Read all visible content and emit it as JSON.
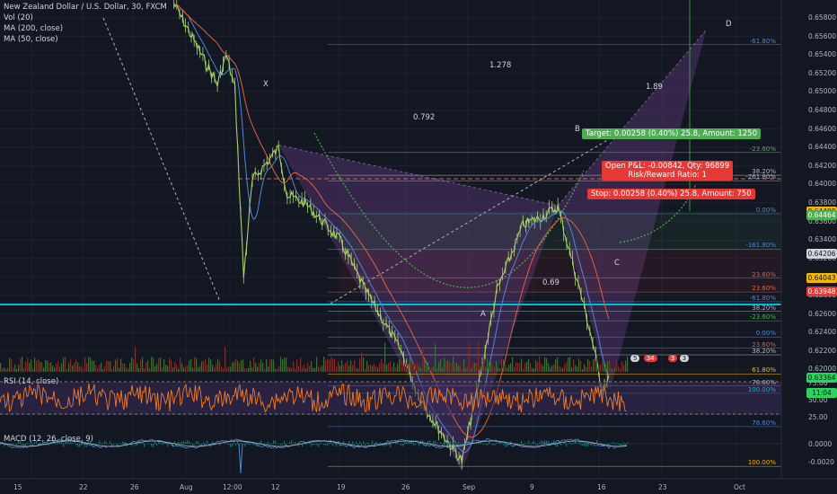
{
  "legend": {
    "symbol": "New Zealand Dollar / U.S. Dollar, 30, FXCM",
    "vol": "Vol (20)",
    "ma200": "MA (200, close)",
    "ma50": "MA (50, close)",
    "rsi": "RSI (14, close)",
    "macd": "MACD (12, 26, close, 9)"
  },
  "colors": {
    "background": "#131722",
    "candle": "#a4d36b",
    "ma200": "#e0613f",
    "ma50": "#4f86d9",
    "harmonic_fill": "#5b3a78",
    "rsi": "#f57c1f",
    "target_box": "#4caf50",
    "stop_box": "#e53935",
    "cup_curve": "#4caf50",
    "support_line": "#00bcd4"
  },
  "price_axis": {
    "ticks": [
      "0.65800",
      "0.65600",
      "0.65400",
      "0.65200",
      "0.65000",
      "0.64800",
      "0.64600",
      "0.64400",
      "0.64200",
      "0.64000",
      "0.63800",
      "0.63600",
      "0.63400",
      "0.63200",
      "0.63000",
      "0.62800",
      "0.62600",
      "0.62400",
      "0.62200",
      "0.62000"
    ],
    "tags": [
      {
        "text": "0.64490",
        "bg": "#f7b500",
        "fg": "#131722",
        "price": 0.6449
      },
      {
        "text": "0.64464",
        "bg": "#4caf50",
        "fg": "#ffffff",
        "price": 0.64464
      },
      {
        "text": "0.64206",
        "bg": "#d1d4dc",
        "fg": "#131722",
        "price": 0.64206
      },
      {
        "text": "0.64043",
        "bg": "#f7b500",
        "fg": "#131722",
        "price": 0.64043
      },
      {
        "text": "0.63948",
        "bg": "#e53935",
        "fg": "#ffffff",
        "price": 0.63948
      },
      {
        "text": "0.63364",
        "bg": "#2bd45b",
        "fg": "#131722",
        "price": 0.63364
      },
      {
        "text": "11:04",
        "bg": "#2bd45b",
        "fg": "#131722",
        "price": 0.63264
      }
    ]
  },
  "time_axis": [
    "15",
    "22",
    "26",
    "Aug",
    "12:00",
    "12",
    "19",
    "26",
    "Sep",
    "9",
    "16",
    "23",
    "Oct"
  ],
  "rsi_axis": [
    "75.00",
    "50.00",
    "25.00"
  ],
  "macd_axis": [
    "0.0000",
    "-0.0020"
  ],
  "pattern": {
    "points": {
      "X": "X",
      "A": "A",
      "B": "B",
      "C": "C",
      "D": "D"
    },
    "ratios": {
      "r1": "1.278",
      "r2": "1.89",
      "r3": "0.792",
      "r4": "0.69"
    }
  },
  "fib_labels": [
    {
      "text": "-61.80%",
      "color": "#4f86d9",
      "price": 0.6562
    },
    {
      "text": "-23.60%",
      "color": "#4caf50",
      "price": 0.6489
    },
    {
      "text": "38.20%",
      "color": "#b2b5be",
      "price": 0.64735
    },
    {
      "text": "-261.80%",
      "color": "#b2b5be",
      "price": 0.64698
    },
    {
      "text": "0.00%",
      "color": "#4f86d9",
      "price": 0.64475
    },
    {
      "text": "-161.80%",
      "color": "#4f86d9",
      "price": 0.64235
    },
    {
      "text": "23.60%",
      "color": "#e0613f",
      "price": 0.6404
    },
    {
      "text": "23.60%",
      "color": "#e0613f",
      "price": 0.63945
    },
    {
      "text": "-61.80%",
      "color": "#4f86d9",
      "price": 0.6388
    },
    {
      "text": "38.20%",
      "color": "#b2b5be",
      "price": 0.63815
    },
    {
      "text": "-23.60%",
      "color": "#4caf50",
      "price": 0.6375
    },
    {
      "text": "0.00%",
      "color": "#4f86d9",
      "price": 0.6364
    },
    {
      "text": "23.60%",
      "color": "#e0613f",
      "price": 0.63565
    },
    {
      "text": "38.20%",
      "color": "#b2b5be",
      "price": 0.6352
    },
    {
      "text": "61.80%",
      "color": "#f7b500",
      "price": 0.6339
    },
    {
      "text": "78.60%",
      "color": "#b2b5be",
      "price": 0.6331
    },
    {
      "text": "100.00%",
      "color": "#00bcd4",
      "price": 0.6326
    },
    {
      "text": "78.60%",
      "color": "#4f86d9",
      "price": 0.63035
    },
    {
      "text": "100.00%",
      "color": "#f7b500",
      "price": 0.62765
    }
  ],
  "positions": {
    "target": "Target: 0.00258 (0.40%) 25.8, Amount: 1250",
    "open_pl": "Open P&L: -0.00842, Qty: 96899",
    "rr": "Risk/Reward Ratio: 1",
    "stop": "Stop: 0.00258 (0.40%) 25.8, Amount: 750"
  },
  "badges": [
    "5",
    "34",
    "3",
    "3"
  ],
  "chart_data": {
    "type": "candlestick",
    "title": "New Zealand Dollar / U.S. Dollar, 30, FXCM",
    "ylim": [
      0.6195,
      0.6595
    ],
    "overlays": [
      "MA (200, close)",
      "MA (50, close)"
    ],
    "price_path": [
      [
        "Jul 31",
        0.659
      ],
      [
        "Aug 2",
        0.6568
      ],
      [
        "Aug 5",
        0.6535
      ],
      [
        "Aug 6",
        0.6555
      ],
      [
        "Aug 7",
        0.6532
      ],
      [
        "Aug 8",
        0.6405
      ],
      [
        "Aug 9",
        0.647
      ],
      [
        "Aug 12",
        0.6492
      ],
      [
        "Aug 13",
        0.646
      ],
      [
        "Aug 15",
        0.6455
      ],
      [
        "Aug 19",
        0.643
      ],
      [
        "Aug 22",
        0.6395
      ],
      [
        "Aug 26",
        0.6355
      ],
      [
        "Aug 28",
        0.6325
      ],
      [
        "Aug 30",
        0.6305
      ],
      [
        "Sep 2",
        0.628
      ],
      [
        "Sep 4",
        0.6335
      ],
      [
        "Sep 6",
        0.6395
      ],
      [
        "Sep 9",
        0.644
      ],
      [
        "Sep 11",
        0.6445
      ],
      [
        "Sep 13",
        0.6452
      ],
      [
        "Sep 16",
        0.6385
      ],
      [
        "Sep 17",
        0.636
      ],
      [
        "Sep 18",
        0.633
      ],
      [
        "Sep 19",
        0.6336
      ]
    ],
    "harmonic_points": [
      {
        "label": "X",
        "date": "Aug 12",
        "price": 0.6494
      },
      {
        "label": "A",
        "date": "Sep 2",
        "price": 0.6273
      },
      {
        "label": "B",
        "date": "Sep 13",
        "price": 0.6453
      },
      {
        "label": "C",
        "date": "Sep 19",
        "price": 0.6328
      },
      {
        "label": "D",
        "date": "Sep 30",
        "price": 0.6572
      }
    ],
    "position": {
      "entry": 0.6422,
      "target": 0.6449,
      "stop": 0.6395
    },
    "rsi": {
      "range": [
        0,
        100
      ],
      "levels": [
        70,
        30
      ],
      "last": 36
    },
    "macd": {
      "last": 0.0
    }
  }
}
